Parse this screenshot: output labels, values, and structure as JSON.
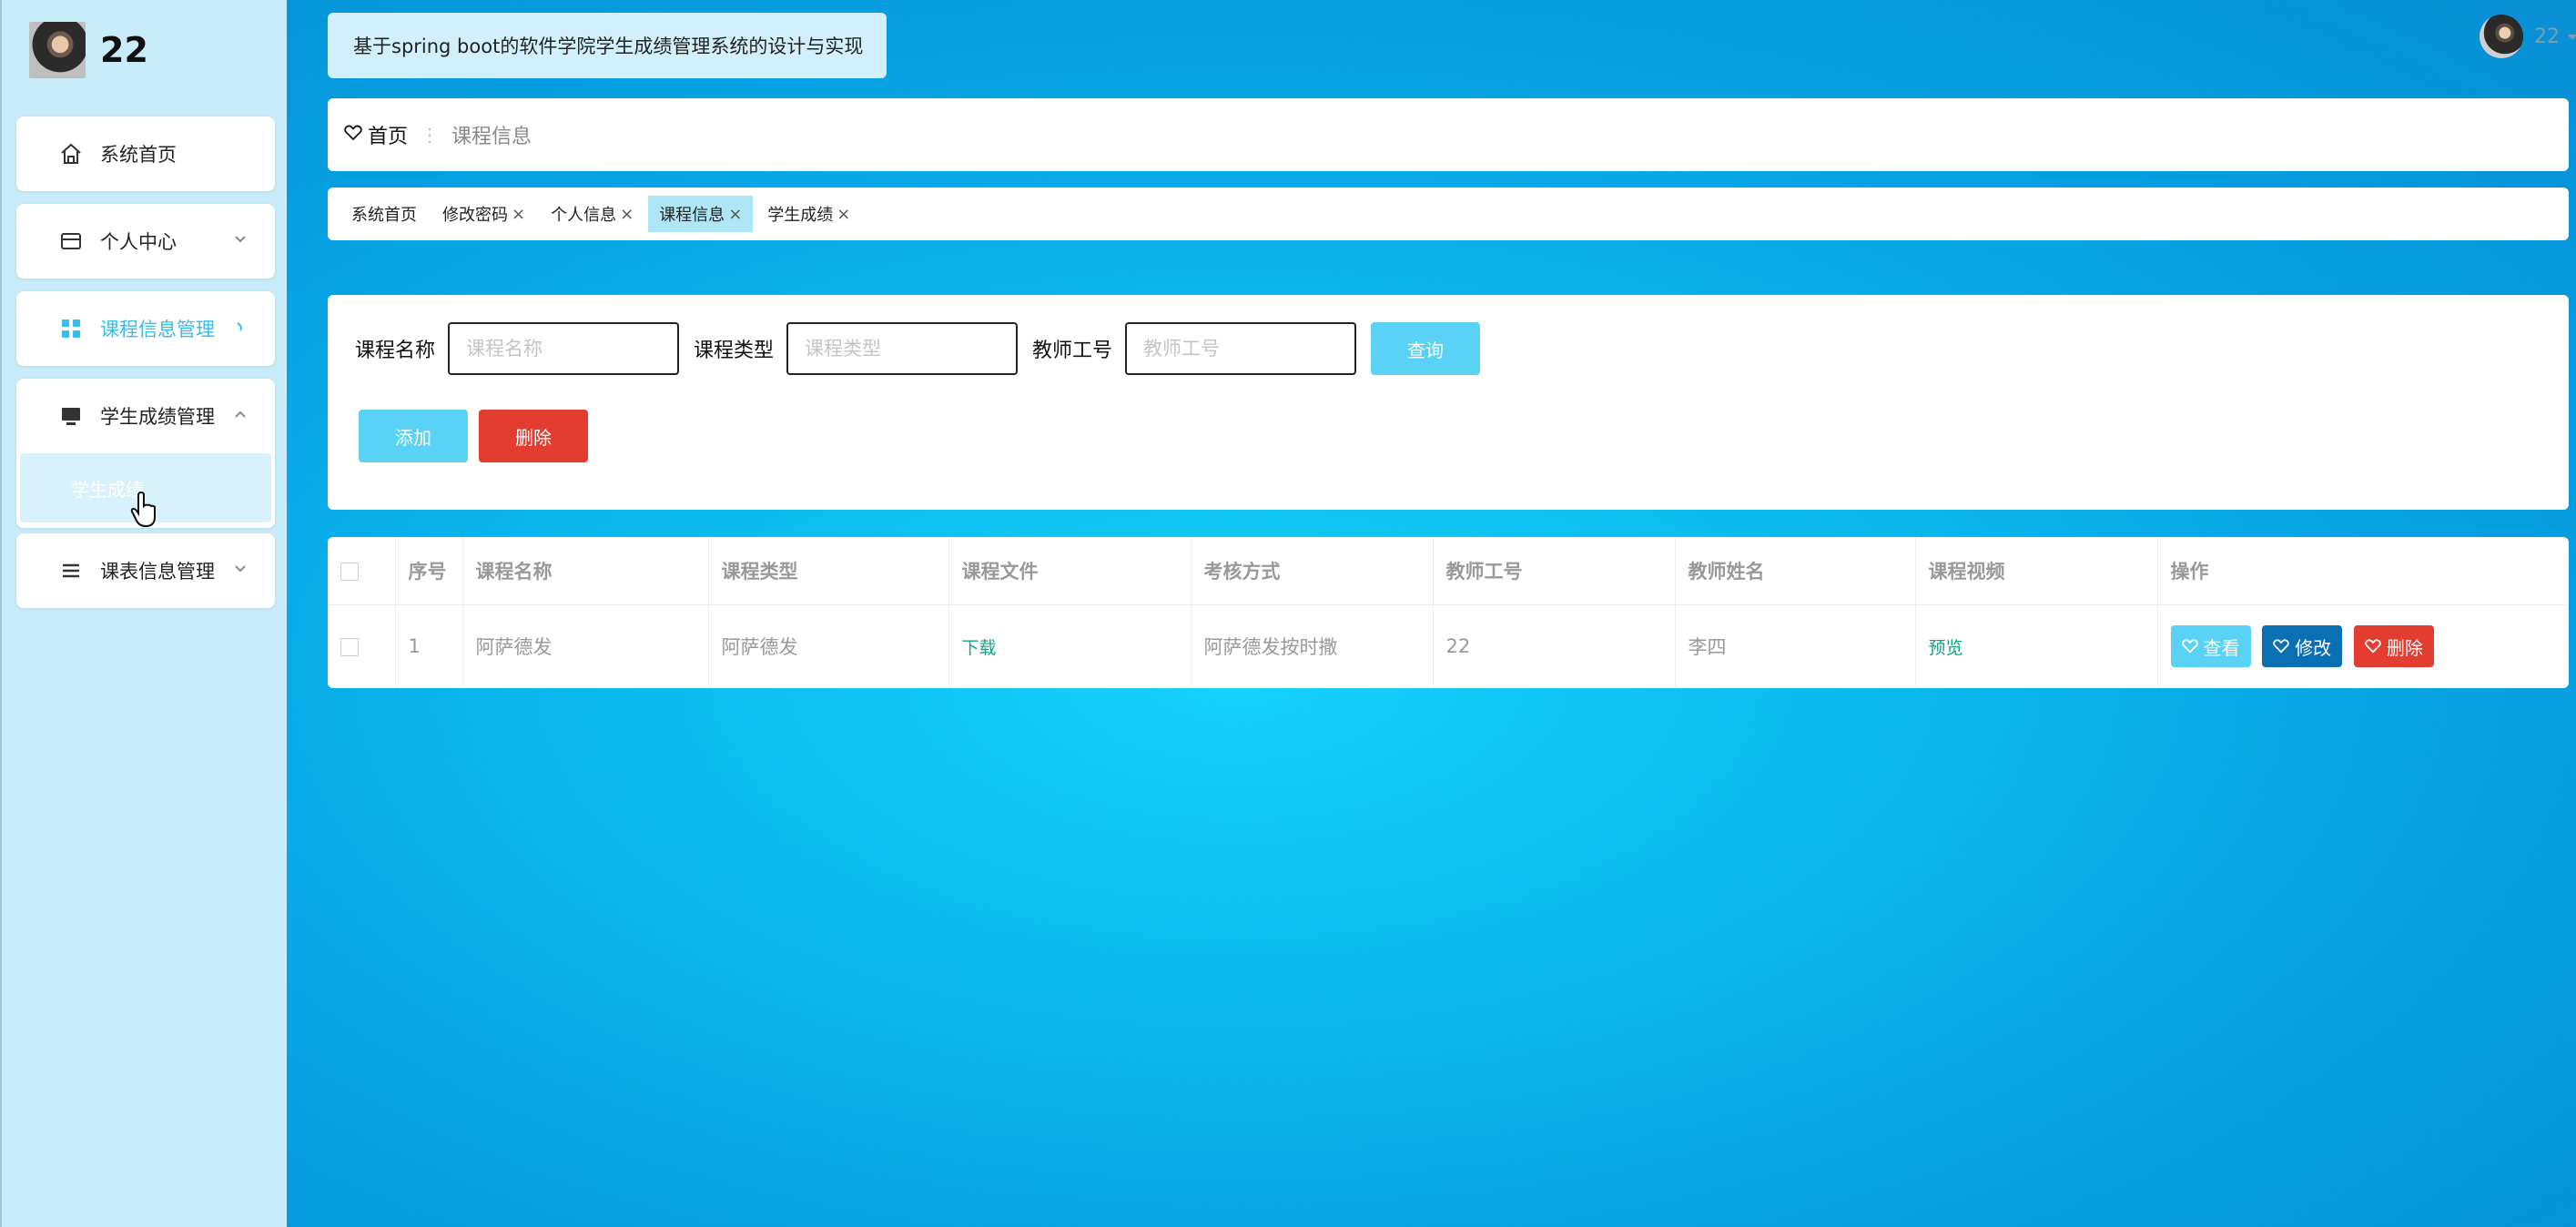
{
  "sidebar": {
    "user_name": "22",
    "items": [
      {
        "label": "系统首页",
        "icon": "home-icon"
      },
      {
        "label": "个人中心",
        "icon": "card-icon"
      },
      {
        "label": "课程信息管理",
        "icon": "grid-icon"
      },
      {
        "label": "学生成绩管理",
        "icon": "monitor-icon"
      },
      {
        "label": "课表信息管理",
        "icon": "list-icon"
      }
    ],
    "submenu_label": "学生成绩"
  },
  "header": {
    "title": "基于spring boot的软件学院学生成绩管理系统的设计与实现",
    "user_name": "22"
  },
  "breadcrumb": {
    "home": "首页",
    "current": "课程信息"
  },
  "tags": [
    {
      "label": "系统首页",
      "closable": false
    },
    {
      "label": "修改密码",
      "closable": true
    },
    {
      "label": "个人信息",
      "closable": true
    },
    {
      "label": "课程信息",
      "closable": true
    },
    {
      "label": "学生成绩",
      "closable": true
    }
  ],
  "search": {
    "course_name_label": "课程名称",
    "course_name_placeholder": "课程名称",
    "course_type_label": "课程类型",
    "course_type_placeholder": "课程类型",
    "teacher_id_label": "教师工号",
    "teacher_id_placeholder": "教师工号",
    "query_label": "查询",
    "add_label": "添加",
    "delete_label": "删除"
  },
  "table": {
    "headers": [
      "序号",
      "课程名称",
      "课程类型",
      "课程文件",
      "考核方式",
      "教师工号",
      "教师姓名",
      "课程视频",
      "操作"
    ],
    "rows": [
      {
        "index": "1",
        "course_name": "阿萨德发",
        "course_type": "阿萨德发",
        "course_file": "下载",
        "exam_method": "阿萨德发按时撒",
        "teacher_id": "22",
        "teacher_name": "李四",
        "course_video": "预览",
        "view_label": "查看",
        "edit_label": "修改",
        "delete_label": "删除"
      }
    ]
  },
  "colors": {
    "accent": "#5ad2f5",
    "danger": "#e23d30",
    "edit": "#0b6fb3",
    "link": "#16a085"
  }
}
